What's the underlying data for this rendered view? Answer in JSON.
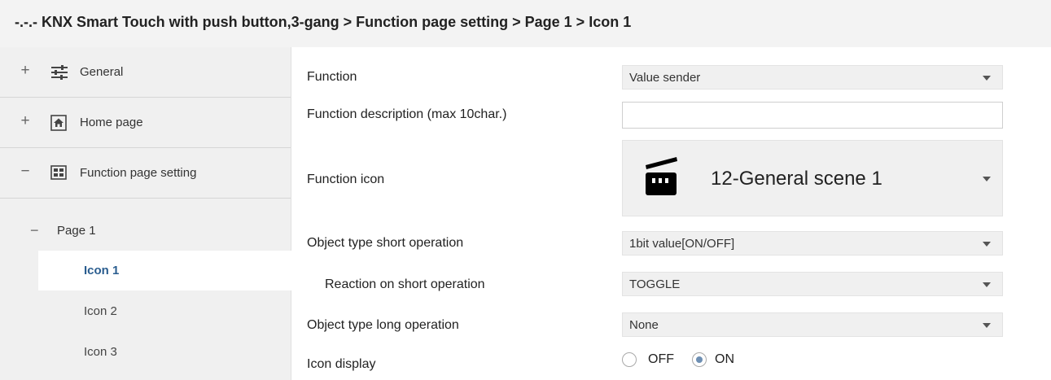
{
  "window": {
    "breadcrumb": "-.-.- KNX Smart Touch with push button,3-gang > Function page setting > Page 1 > Icon 1"
  },
  "sidebar": {
    "items": [
      {
        "expander": "+",
        "icon": "sliders-icon",
        "label": "General"
      },
      {
        "expander": "+",
        "icon": "home-icon",
        "label": "Home page"
      },
      {
        "expander": "−",
        "icon": "grid-icon",
        "label": "Function page setting"
      }
    ],
    "page": {
      "expander": "−",
      "label": "Page 1"
    },
    "subitems": [
      {
        "label": "Icon 1",
        "active": true
      },
      {
        "label": "Icon 2",
        "active": false
      },
      {
        "label": "Icon 3",
        "active": false
      }
    ]
  },
  "params": {
    "function": {
      "label": "Function",
      "value": "Value sender"
    },
    "description": {
      "label": "Function description (max 10char.)",
      "value": ""
    },
    "icon": {
      "label": "Function icon",
      "value": "12-General scene 1",
      "icon": "clapperboard-icon"
    },
    "short_type": {
      "label": "Object type short operation",
      "value": "1bit value[ON/OFF]"
    },
    "short_reaction": {
      "label": "Reaction on short operation",
      "value": "TOGGLE"
    },
    "long_type": {
      "label": "Object type long operation",
      "value": "None"
    },
    "display": {
      "label": "Icon display",
      "options": [
        "OFF",
        "ON"
      ],
      "selected": "ON"
    }
  }
}
